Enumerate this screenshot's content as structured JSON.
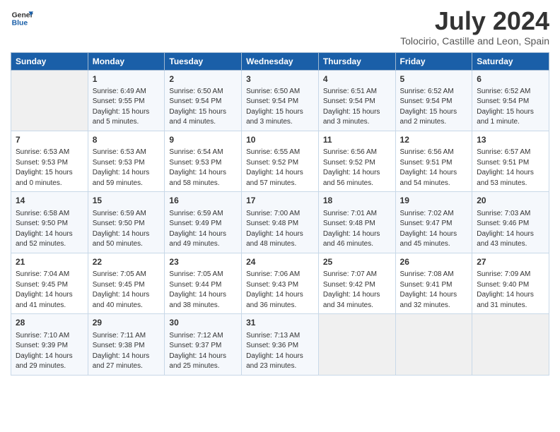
{
  "logo": {
    "line1": "General",
    "line2": "Blue"
  },
  "title": "July 2024",
  "subtitle": "Tolocirio, Castille and Leon, Spain",
  "days_header": [
    "Sunday",
    "Monday",
    "Tuesday",
    "Wednesday",
    "Thursday",
    "Friday",
    "Saturday"
  ],
  "weeks": [
    [
      {
        "day": "",
        "info": ""
      },
      {
        "day": "1",
        "info": "Sunrise: 6:49 AM\nSunset: 9:55 PM\nDaylight: 15 hours\nand 5 minutes."
      },
      {
        "day": "2",
        "info": "Sunrise: 6:50 AM\nSunset: 9:54 PM\nDaylight: 15 hours\nand 4 minutes."
      },
      {
        "day": "3",
        "info": "Sunrise: 6:50 AM\nSunset: 9:54 PM\nDaylight: 15 hours\nand 3 minutes."
      },
      {
        "day": "4",
        "info": "Sunrise: 6:51 AM\nSunset: 9:54 PM\nDaylight: 15 hours\nand 3 minutes."
      },
      {
        "day": "5",
        "info": "Sunrise: 6:52 AM\nSunset: 9:54 PM\nDaylight: 15 hours\nand 2 minutes."
      },
      {
        "day": "6",
        "info": "Sunrise: 6:52 AM\nSunset: 9:54 PM\nDaylight: 15 hours\nand 1 minute."
      }
    ],
    [
      {
        "day": "7",
        "info": "Sunrise: 6:53 AM\nSunset: 9:53 PM\nDaylight: 15 hours\nand 0 minutes."
      },
      {
        "day": "8",
        "info": "Sunrise: 6:53 AM\nSunset: 9:53 PM\nDaylight: 14 hours\nand 59 minutes."
      },
      {
        "day": "9",
        "info": "Sunrise: 6:54 AM\nSunset: 9:53 PM\nDaylight: 14 hours\nand 58 minutes."
      },
      {
        "day": "10",
        "info": "Sunrise: 6:55 AM\nSunset: 9:52 PM\nDaylight: 14 hours\nand 57 minutes."
      },
      {
        "day": "11",
        "info": "Sunrise: 6:56 AM\nSunset: 9:52 PM\nDaylight: 14 hours\nand 56 minutes."
      },
      {
        "day": "12",
        "info": "Sunrise: 6:56 AM\nSunset: 9:51 PM\nDaylight: 14 hours\nand 54 minutes."
      },
      {
        "day": "13",
        "info": "Sunrise: 6:57 AM\nSunset: 9:51 PM\nDaylight: 14 hours\nand 53 minutes."
      }
    ],
    [
      {
        "day": "14",
        "info": "Sunrise: 6:58 AM\nSunset: 9:50 PM\nDaylight: 14 hours\nand 52 minutes."
      },
      {
        "day": "15",
        "info": "Sunrise: 6:59 AM\nSunset: 9:50 PM\nDaylight: 14 hours\nand 50 minutes."
      },
      {
        "day": "16",
        "info": "Sunrise: 6:59 AM\nSunset: 9:49 PM\nDaylight: 14 hours\nand 49 minutes."
      },
      {
        "day": "17",
        "info": "Sunrise: 7:00 AM\nSunset: 9:48 PM\nDaylight: 14 hours\nand 48 minutes."
      },
      {
        "day": "18",
        "info": "Sunrise: 7:01 AM\nSunset: 9:48 PM\nDaylight: 14 hours\nand 46 minutes."
      },
      {
        "day": "19",
        "info": "Sunrise: 7:02 AM\nSunset: 9:47 PM\nDaylight: 14 hours\nand 45 minutes."
      },
      {
        "day": "20",
        "info": "Sunrise: 7:03 AM\nSunset: 9:46 PM\nDaylight: 14 hours\nand 43 minutes."
      }
    ],
    [
      {
        "day": "21",
        "info": "Sunrise: 7:04 AM\nSunset: 9:45 PM\nDaylight: 14 hours\nand 41 minutes."
      },
      {
        "day": "22",
        "info": "Sunrise: 7:05 AM\nSunset: 9:45 PM\nDaylight: 14 hours\nand 40 minutes."
      },
      {
        "day": "23",
        "info": "Sunrise: 7:05 AM\nSunset: 9:44 PM\nDaylight: 14 hours\nand 38 minutes."
      },
      {
        "day": "24",
        "info": "Sunrise: 7:06 AM\nSunset: 9:43 PM\nDaylight: 14 hours\nand 36 minutes."
      },
      {
        "day": "25",
        "info": "Sunrise: 7:07 AM\nSunset: 9:42 PM\nDaylight: 14 hours\nand 34 minutes."
      },
      {
        "day": "26",
        "info": "Sunrise: 7:08 AM\nSunset: 9:41 PM\nDaylight: 14 hours\nand 32 minutes."
      },
      {
        "day": "27",
        "info": "Sunrise: 7:09 AM\nSunset: 9:40 PM\nDaylight: 14 hours\nand 31 minutes."
      }
    ],
    [
      {
        "day": "28",
        "info": "Sunrise: 7:10 AM\nSunset: 9:39 PM\nDaylight: 14 hours\nand 29 minutes."
      },
      {
        "day": "29",
        "info": "Sunrise: 7:11 AM\nSunset: 9:38 PM\nDaylight: 14 hours\nand 27 minutes."
      },
      {
        "day": "30",
        "info": "Sunrise: 7:12 AM\nSunset: 9:37 PM\nDaylight: 14 hours\nand 25 minutes."
      },
      {
        "day": "31",
        "info": "Sunrise: 7:13 AM\nSunset: 9:36 PM\nDaylight: 14 hours\nand 23 minutes."
      },
      {
        "day": "",
        "info": ""
      },
      {
        "day": "",
        "info": ""
      },
      {
        "day": "",
        "info": ""
      }
    ]
  ]
}
